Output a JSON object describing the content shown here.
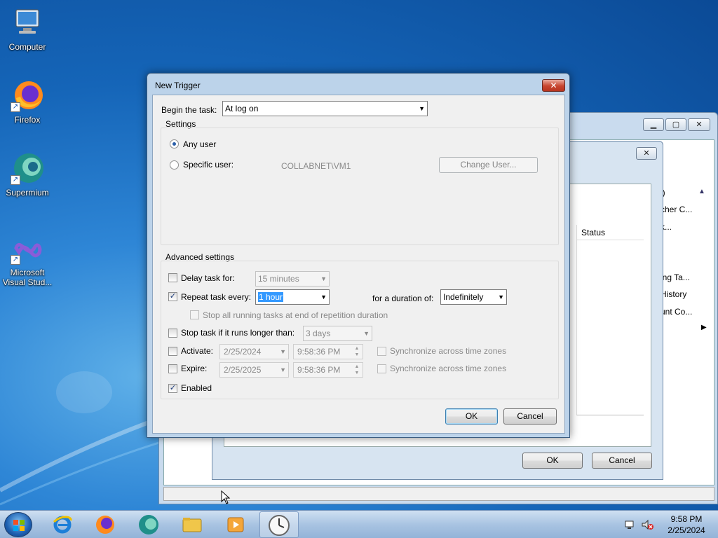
{
  "desktop": {
    "icons": [
      {
        "label": "Computer"
      },
      {
        "label": "Firefox"
      },
      {
        "label": "Supermium"
      },
      {
        "label": "Microsoft Visual Stud..."
      }
    ]
  },
  "background_window": {
    "column_header": "Status",
    "right_list": [
      "l)",
      "cher C...",
      "k...",
      "ing Ta...",
      "History",
      "unt Co..."
    ],
    "ok_label": "OK",
    "cancel_label": "Cancel"
  },
  "dialog": {
    "title": "New Trigger",
    "close_label": "✕",
    "begin_label": "Begin the task:",
    "begin_value": "At log on",
    "settings_label": "Settings",
    "any_user_label": "Any user",
    "specific_user_label": "Specific user:",
    "user_value": "COLLABNET\\VM1",
    "change_user_label": "Change User...",
    "advanced_label": "Advanced settings",
    "delay_label": "Delay task for:",
    "delay_value": "15 minutes",
    "repeat_label": "Repeat task every:",
    "repeat_value": "1 hour",
    "duration_label": "for a duration of:",
    "duration_value": "Indefinitely",
    "stop_running_label": "Stop all running tasks at end of repetition duration",
    "stop_longer_label": "Stop task if it runs longer than:",
    "stop_longer_value": "3 days",
    "activate_label": "Activate:",
    "activate_date": "2/25/2024",
    "activate_time": "9:58:36 PM",
    "expire_label": "Expire:",
    "expire_date": "2/25/2025",
    "expire_time": "9:58:36 PM",
    "sync_label": "Synchronize across time zones",
    "enabled_label": "Enabled",
    "ok_label": "OK",
    "cancel_label": "Cancel"
  },
  "taskbar": {
    "time": "9:58 PM",
    "date": "2/25/2024"
  }
}
